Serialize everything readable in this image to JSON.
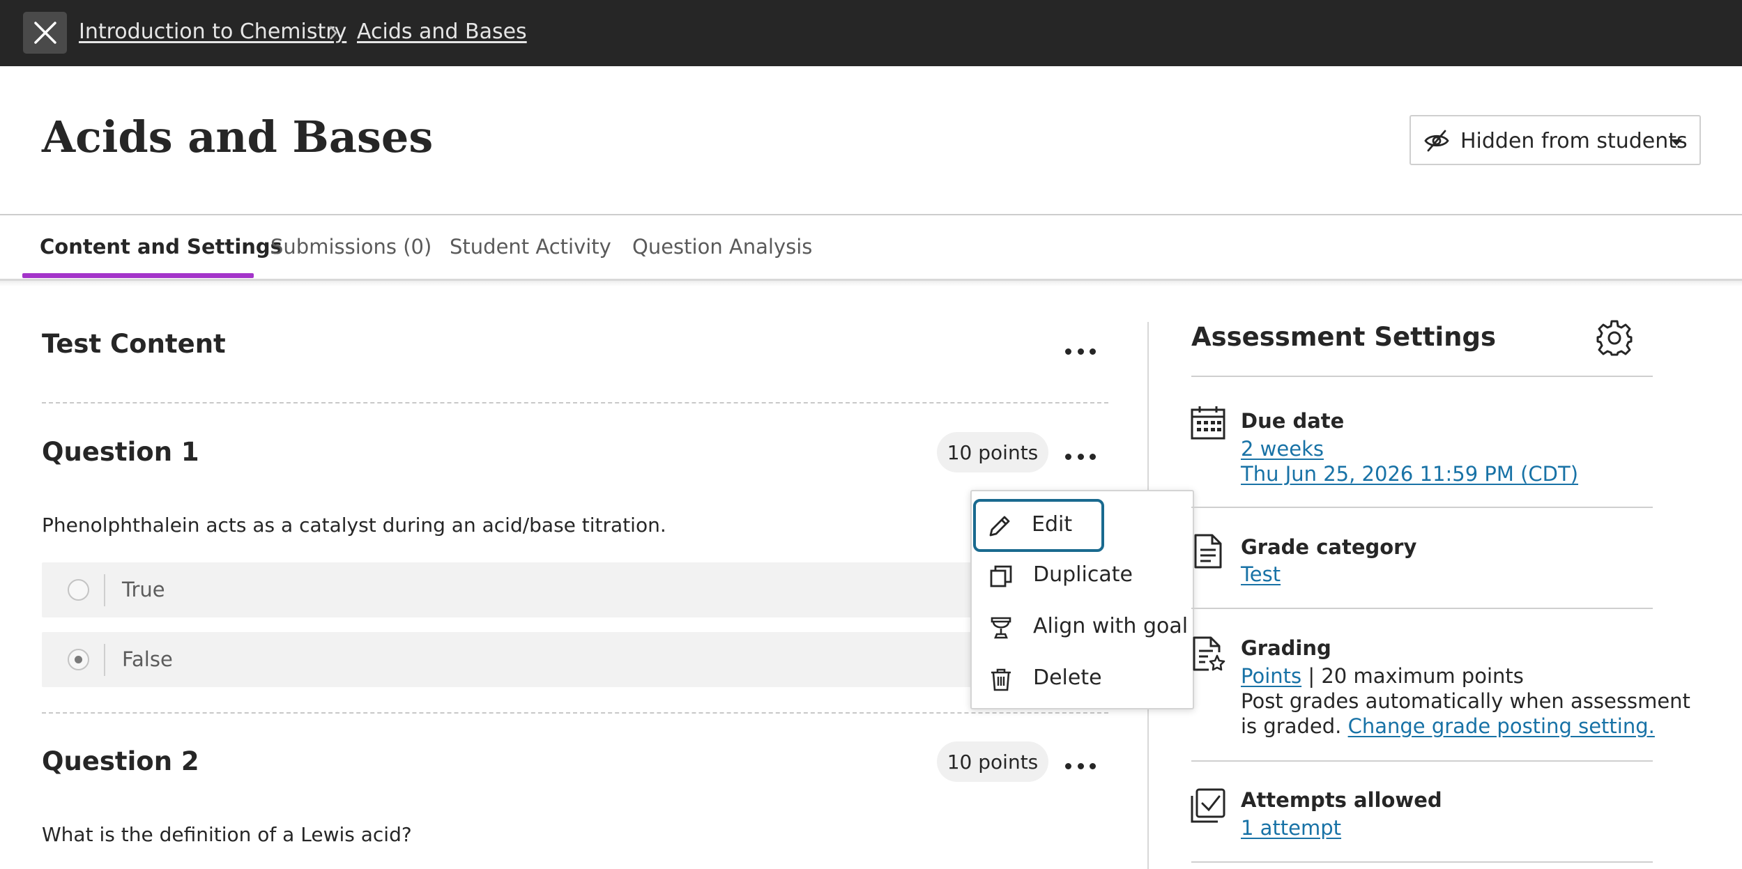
{
  "breadcrumb": {
    "close_icon": "close-icon",
    "items": [
      "Introduction to Chemistry",
      "Acids and Bases"
    ]
  },
  "header": {
    "title": "Acids and Bases",
    "visibility": {
      "label": "Hidden from students",
      "icon": "eye-slash-icon"
    }
  },
  "tabs": [
    {
      "label": "Content and Settings",
      "active": true
    },
    {
      "label": "Submissions (0)"
    },
    {
      "label": "Student Activity"
    },
    {
      "label": "Question Analysis"
    }
  ],
  "content": {
    "section_title": "Test Content",
    "questions": [
      {
        "title": "Question 1",
        "points": "10 points",
        "text": "Phenolphthalein acts as a catalyst during an acid/base titration.",
        "answers": [
          {
            "label": "True",
            "selected": false
          },
          {
            "label": "False",
            "selected": true
          }
        ]
      },
      {
        "title": "Question 2",
        "points": "10 points",
        "text": "What is the definition of a Lewis acid?"
      }
    ]
  },
  "context_menu": {
    "items": [
      {
        "label": "Edit",
        "icon": "pencil-icon"
      },
      {
        "label": "Duplicate",
        "icon": "duplicate-icon"
      },
      {
        "label": "Align with goal",
        "icon": "trophy-icon"
      },
      {
        "label": "Delete",
        "icon": "trash-icon"
      }
    ]
  },
  "settings": {
    "title": "Assessment Settings",
    "due_date": {
      "label": "Due date",
      "relative": "2 weeks",
      "date": "Thu Jun 25, 2026 11:59 PM (CDT)"
    },
    "grade_category": {
      "label": "Grade category",
      "value": "Test"
    },
    "grading": {
      "label": "Grading",
      "schema": "Points",
      "max_points": " | 20 maximum points",
      "posting_line1": "Post grades automatically when assessment",
      "posting_line2": "is graded. ",
      "posting_link": "Change grade posting setting."
    },
    "attempts": {
      "label": "Attempts allowed",
      "value": "1 attempt"
    }
  },
  "colors": {
    "topbar": "#262626",
    "accent_tab": "#a334c9",
    "link": "#1872a6",
    "focus_ring": "#1a6a8f"
  }
}
